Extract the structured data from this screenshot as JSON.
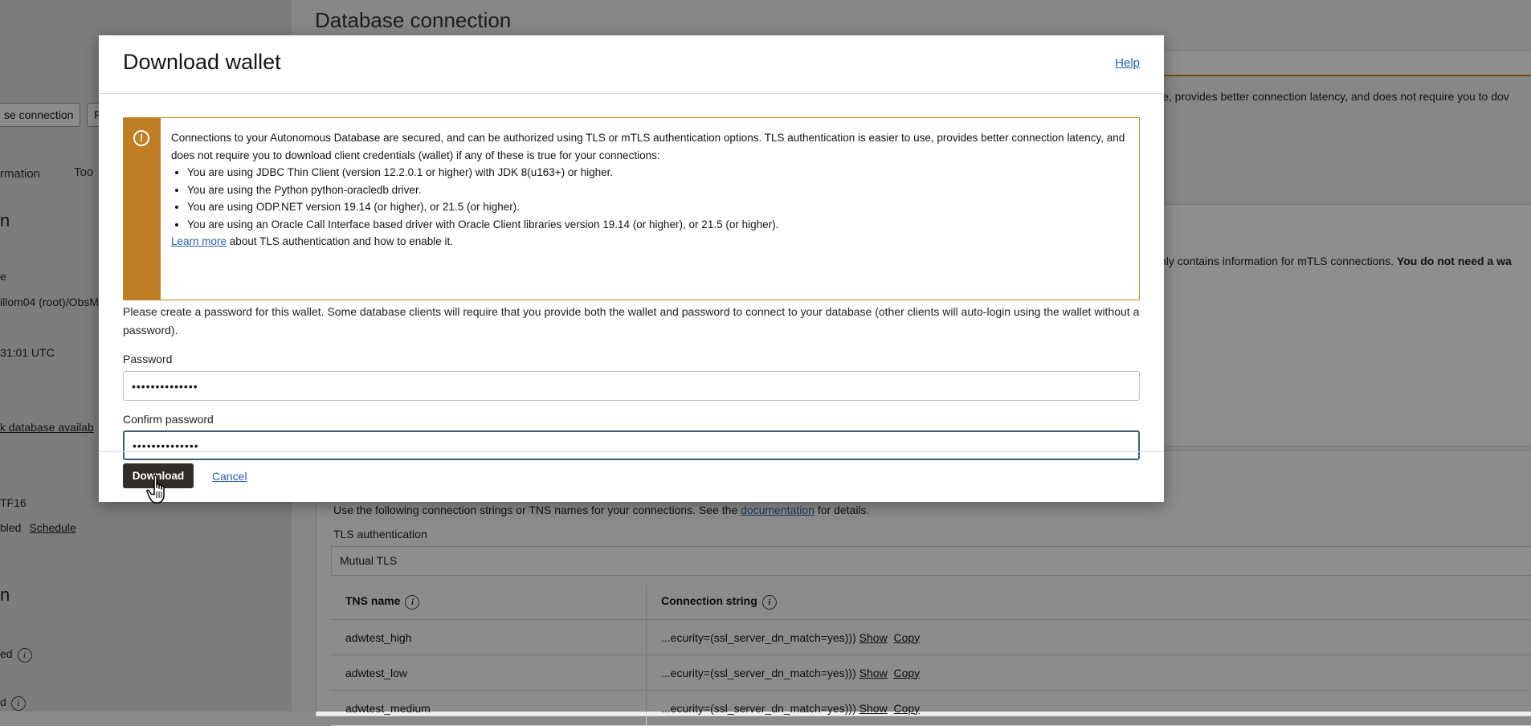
{
  "background": {
    "page_title": "Database connection",
    "left_button_1": "se connection",
    "left_button_2": "F",
    "tab_1": "rmation",
    "tab_2": "Too",
    "left_heading_1": "n",
    "left_text_1": "e",
    "left_text_2": "illom04 (root)/ObsM",
    "left_text_3": "31:01 UTC",
    "left_link_1": "k database availab",
    "left_text_4": "TF16",
    "left_text_5": "bled",
    "left_link_schedule": "Schedule",
    "left_heading_2": "n",
    "left_text_6": "ed",
    "left_text_7": "d",
    "right_text_1": "ise, provides better connection latency, and does not require you to dov",
    "right_text_2_normal": "nly contains information for mTLS connections. ",
    "right_text_2_bold": "You do not need a wa",
    "conn_desc_pre": "Use the following connection strings or TNS names for your connections. See the ",
    "conn_desc_link": "documentation",
    "conn_desc_post": " for details.",
    "tls_label": "TLS authentication",
    "tls_value": "Mutual TLS",
    "table": {
      "headers": [
        "TNS name",
        "Connection string"
      ],
      "rows": [
        {
          "name": "adwtest_high",
          "conn": "...ecurity=(ssl_server_dn_match=yes)))",
          "show": "Show",
          "copy": "Copy"
        },
        {
          "name": "adwtest_low",
          "conn": "...ecurity=(ssl_server_dn_match=yes)))",
          "show": "Show",
          "copy": "Copy"
        },
        {
          "name": "adwtest_medium",
          "conn": "...ecurity=(ssl_server_dn_match=yes)))",
          "show": "Show",
          "copy": "Copy"
        }
      ]
    }
  },
  "modal": {
    "title": "Download wallet",
    "help": "Help",
    "alert": {
      "intro": "Connections to your Autonomous Database are secured, and can be authorized using TLS or mTLS authentication options. TLS authentication is easier to use, provides better connection latency, and does not require you to download client credentials (wallet) if any of these is true for your connections:",
      "items": [
        "You are using JDBC Thin Client (version 12.2.0.1 or higher) with JDK 8(u163+) or higher.",
        "You are using the Python python-oracledb driver.",
        "You are using ODP.NET version 19.14 (or higher), or 21.5 (or higher).",
        "You are using an Oracle Call Interface based driver with Oracle Client libraries version 19.14 (or higher), or 21.5 (or higher)."
      ],
      "learn_more": "Learn more",
      "learn_more_suffix": " about TLS authentication and how to enable it."
    },
    "description": "Please create a password for this wallet. Some database clients will require that you provide both the wallet and password to connect to your database (other clients will auto-login using the wallet without a password).",
    "password_label": "Password",
    "password_value": "••••••••••••••",
    "confirm_label": "Confirm password",
    "confirm_value": "••••••••••••••",
    "download_label": "Download",
    "cancel_label": "Cancel"
  },
  "colors": {
    "alert_accent": "#c07d24",
    "primary_button": "#312d2a",
    "link": "#2b5ea7"
  },
  "icons": [
    "warning-icon",
    "info-icon",
    "hand-pointer-cursor-icon"
  ]
}
